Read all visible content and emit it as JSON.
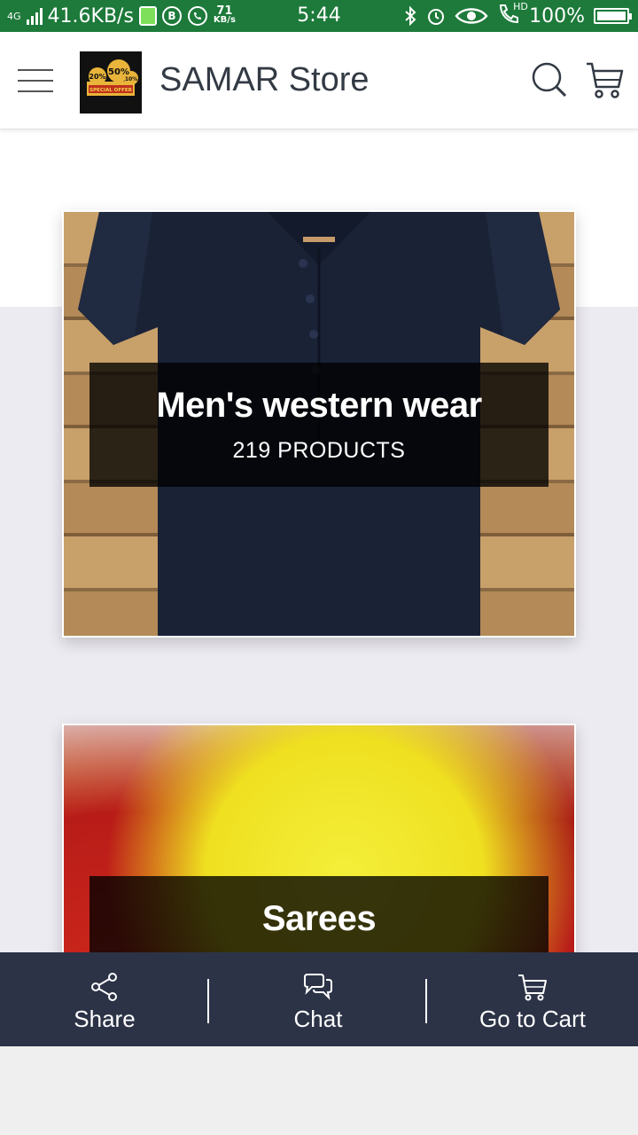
{
  "status_bar": {
    "network": "4G",
    "speed": "41.6KB/s",
    "b_badge": "B",
    "kbs_value": "71",
    "kbs_unit": "KB/s",
    "time": "5:44",
    "hd": "HD",
    "battery": "100%"
  },
  "app_bar": {
    "title": "SAMAR Store",
    "logo_text": {
      "a": "20%",
      "b": "50%",
      "c": "10%",
      "d": "SPECIAL OFFER"
    }
  },
  "categories": [
    {
      "title": "Men's western wear",
      "count": "219 PRODUCTS"
    },
    {
      "title": "Sarees",
      "count": ""
    }
  ],
  "bottom_bar": {
    "share": "Share",
    "chat": "Chat",
    "cart": "Go to Cart"
  },
  "colors": {
    "status_bar": "#1d7a3a",
    "bottom_bar": "#2c3347",
    "title_text": "#333a44"
  }
}
